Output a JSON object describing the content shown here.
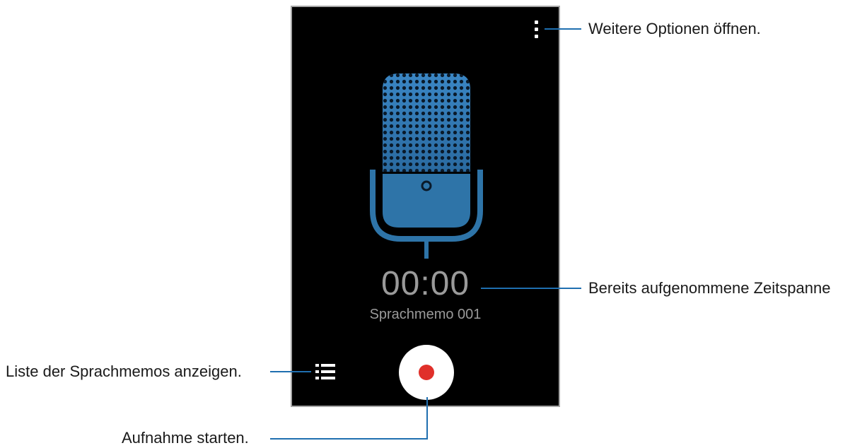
{
  "screen": {
    "timer": "00:00",
    "memo_name": "Sprachmemo 001"
  },
  "callouts": {
    "more_options": "Weitere Optionen öffnen.",
    "elapsed_time": "Bereits aufgenommene Zeitspanne",
    "memo_list": "Liste der Sprachmemos anzeigen.",
    "start_recording": "Aufnahme starten."
  },
  "icons": {
    "menu": "more-vertical-icon",
    "microphone": "microphone-icon",
    "list": "list-icon",
    "record": "record-icon"
  },
  "colors": {
    "screen_background": "#000000",
    "microphone": "#2e74a8",
    "record_dot": "#e0302a",
    "callout_line": "#1f6fb0"
  }
}
